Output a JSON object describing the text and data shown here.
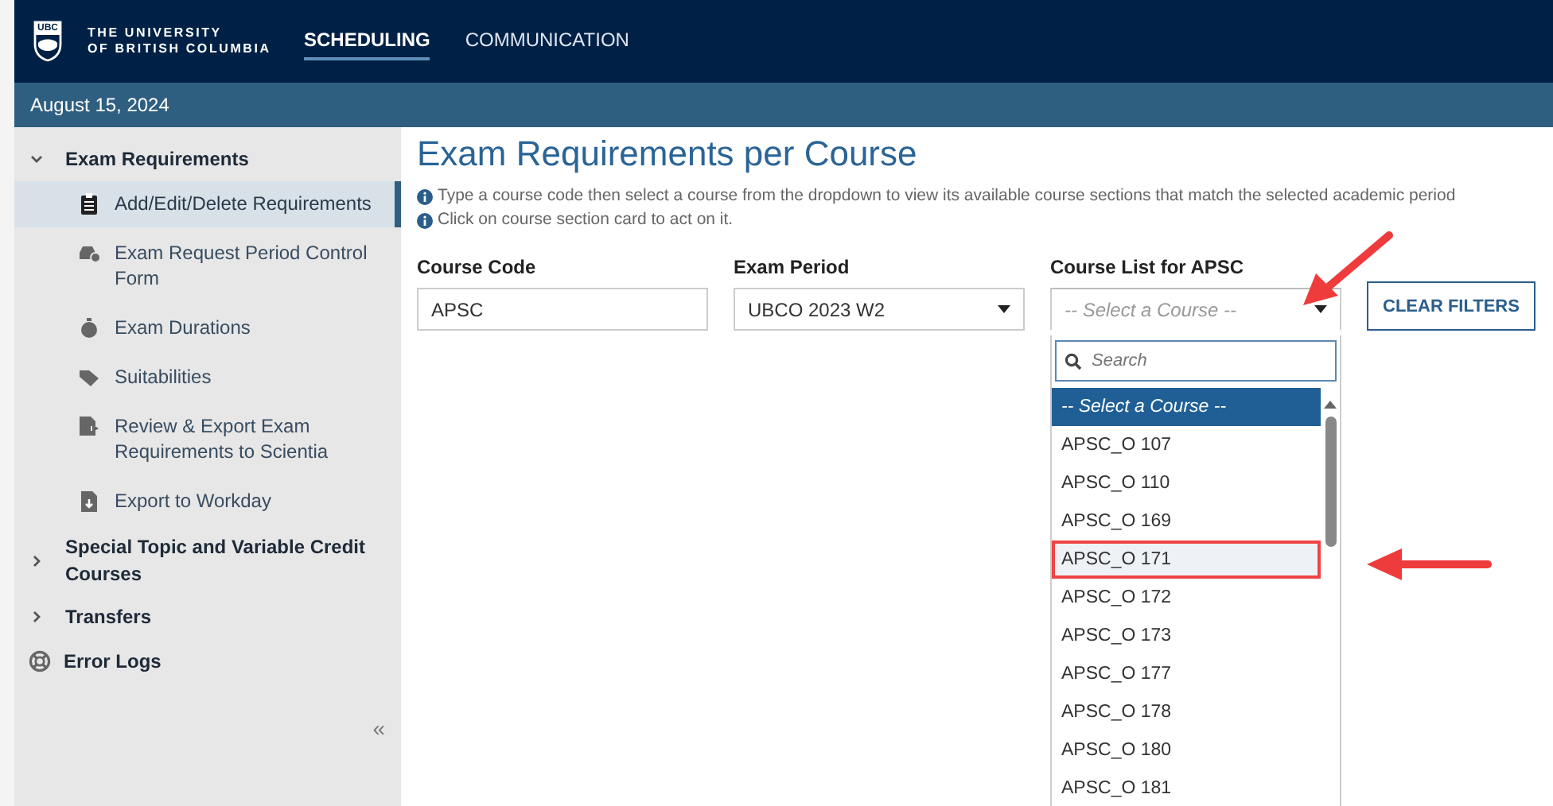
{
  "header": {
    "logo_badge": "UBC",
    "logo_lines": [
      "THE UNIVERSITY",
      "OF BRITISH COLUMBIA"
    ],
    "tabs": [
      {
        "label": "SCHEDULING",
        "selected": true
      },
      {
        "label": "COMMUNICATION",
        "selected": false
      }
    ]
  },
  "date_bar": "August 15, 2024",
  "sidebar": {
    "items": [
      {
        "label": "Exam Requirements",
        "kind": "group",
        "expanded": true,
        "children": [
          {
            "label": "Add/Edit/Delete Requirements",
            "selected": true
          },
          {
            "label": "Exam Request Period Control Form",
            "selected": false
          },
          {
            "label": "Exam Durations",
            "selected": false
          },
          {
            "label": "Suitabilities",
            "selected": false
          },
          {
            "label": "Review & Export Exam Requirements to Scientia",
            "selected": false
          },
          {
            "label": "Export to Workday",
            "selected": false
          }
        ]
      },
      {
        "label": "Special Topic and Variable Credit Courses",
        "kind": "group",
        "expanded": false
      },
      {
        "label": "Transfers",
        "kind": "group",
        "expanded": false
      },
      {
        "label": "Error Logs",
        "kind": "link"
      }
    ],
    "collapse": "«"
  },
  "main": {
    "title": "Exam Requirements per Course",
    "hints": [
      "Type a course code then select a course from the dropdown to view its available course sections that match the selected academic period",
      "Click on course section card to act on it."
    ],
    "course_code": {
      "label": "Course Code",
      "value": "APSC"
    },
    "exam_period": {
      "label": "Exam Period",
      "value": "UBCO 2023 W2"
    },
    "course_list": {
      "label": "Course List for APSC",
      "placeholder": "-- Select a Course --",
      "expanded": true
    },
    "clear_button": "CLEAR FILTERS",
    "dropdown": {
      "search_placeholder": "Search",
      "options": [
        {
          "label": "-- Select a Course --",
          "selected": true,
          "highlighted": false
        },
        {
          "label": "APSC_O 107",
          "selected": false,
          "highlighted": false
        },
        {
          "label": "APSC_O 110",
          "selected": false,
          "highlighted": false
        },
        {
          "label": "APSC_O 169",
          "selected": false,
          "highlighted": false
        },
        {
          "label": "APSC_O 171",
          "selected": false,
          "highlighted": true
        },
        {
          "label": "APSC_O 172",
          "selected": false,
          "highlighted": false
        },
        {
          "label": "APSC_O 173",
          "selected": false,
          "highlighted": false
        },
        {
          "label": "APSC_O 177",
          "selected": false,
          "highlighted": false
        },
        {
          "label": "APSC_O 178",
          "selected": false,
          "highlighted": false
        },
        {
          "label": "APSC_O 180",
          "selected": false,
          "highlighted": false
        },
        {
          "label": "APSC_O 181",
          "selected": false,
          "highlighted": false
        }
      ]
    }
  }
}
